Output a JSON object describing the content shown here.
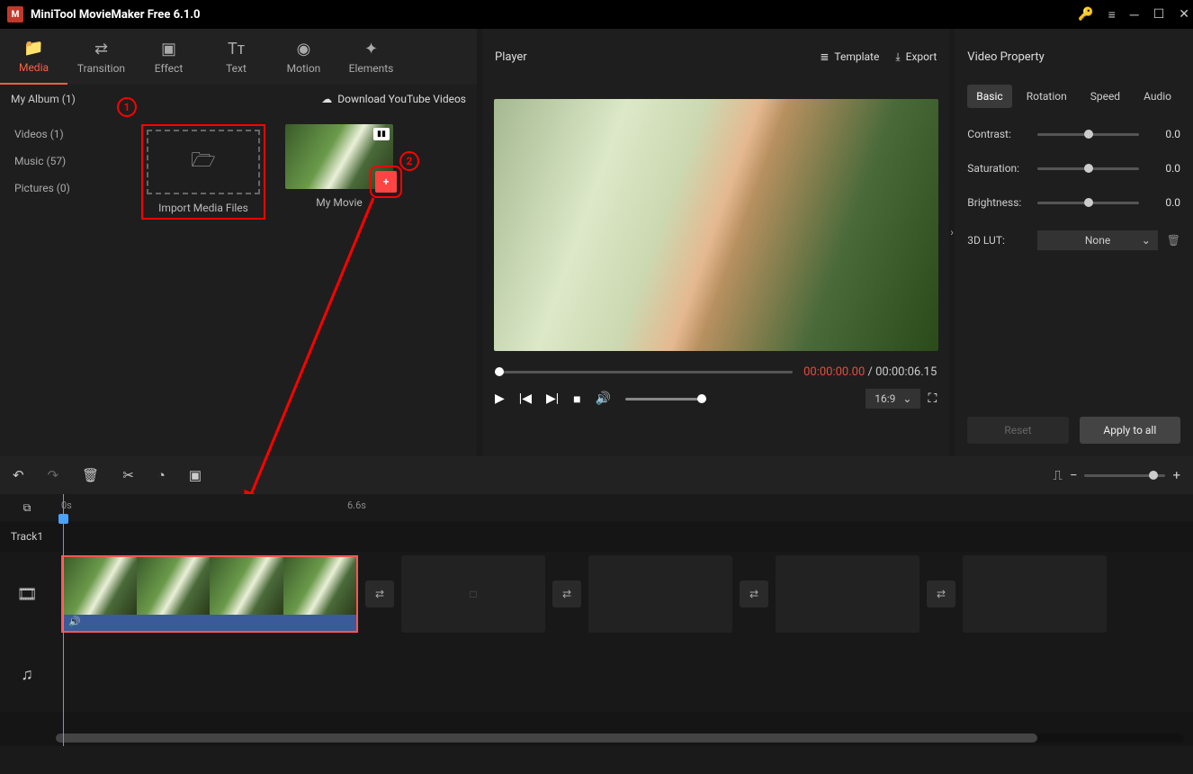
{
  "app": {
    "title": "MiniTool MovieMaker Free 6.1.0"
  },
  "tabs": {
    "media": "Media",
    "transition": "Transition",
    "effect": "Effect",
    "text": "Text",
    "motion": "Motion",
    "elements": "Elements"
  },
  "media": {
    "album": "My Album (1)",
    "download_yt": "Download YouTube Videos",
    "side": {
      "videos": "Videos (1)",
      "music": "Music (57)",
      "pictures": "Pictures (0)"
    },
    "import_label": "Import Media Files",
    "clip1_label": "My Movie"
  },
  "annotations": {
    "n1": "1",
    "n2": "2"
  },
  "player": {
    "title": "Player",
    "template": "Template",
    "export": "Export",
    "time_cur": "00:00:00.00",
    "time_sep": " / ",
    "time_dur": "00:00:06.15",
    "aspect": "16:9"
  },
  "property": {
    "title": "Video Property",
    "tabs": {
      "basic": "Basic",
      "rotation": "Rotation",
      "speed": "Speed",
      "audio": "Audio"
    },
    "contrast": {
      "label": "Contrast:",
      "value": "0.0"
    },
    "saturation": {
      "label": "Saturation:",
      "value": "0.0"
    },
    "brightness": {
      "label": "Brightness:",
      "value": "0.0"
    },
    "lut": {
      "label": "3D LUT:",
      "value": "None"
    },
    "reset": "Reset",
    "apply": "Apply to all"
  },
  "timeline": {
    "mark0": "0s",
    "mark1": "6.6s",
    "track1": "Track1"
  }
}
